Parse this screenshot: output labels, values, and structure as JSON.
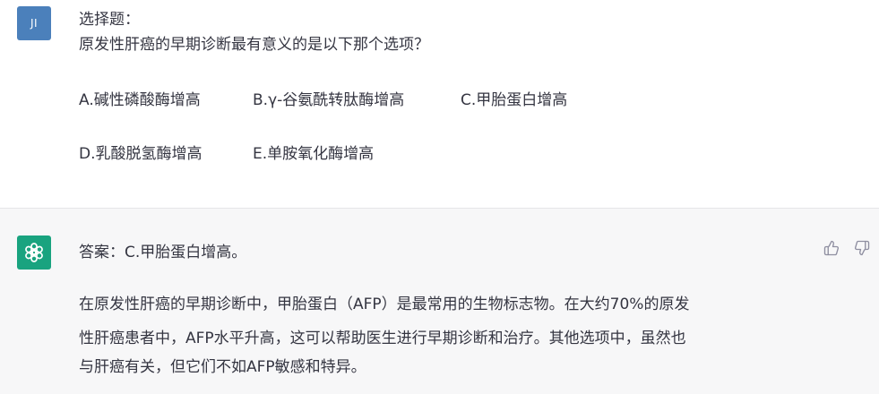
{
  "user": {
    "avatar_initials": "JI",
    "avatar_color": "#4b80bb",
    "question_type": "选择题：",
    "question": "原发性肝癌的早期诊断最有意义的是以下那个选项？",
    "options": [
      "A.碱性磷酸酶增高",
      "B.γ-谷氨酰转肽酶增高",
      "C.甲胎蛋白增高",
      "D.乳酸脱氢酶增高",
      "E.单胺氧化酶增高"
    ]
  },
  "assistant": {
    "avatar_icon": "openai-logo-icon",
    "avatar_color": "#19a37f",
    "answer_line": "答案：C.甲胎蛋白增高。",
    "explanation_lines": [
      "在原发性肝癌的早期诊断中，甲胎蛋白（AFP）是最常用的生物标志物。在大约70%的原发",
      "性肝癌患者中，AFP水平升高，这可以帮助医生进行早期诊断和治疗。其他选项中，虽然也",
      "与肝癌有关，但它们不如AFP敏感和特异。"
    ],
    "feedback_icons": [
      "thumbs-up-icon",
      "thumbs-down-icon"
    ]
  }
}
